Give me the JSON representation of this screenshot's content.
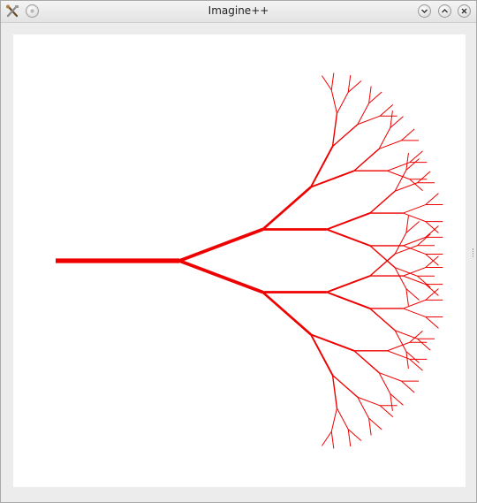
{
  "window": {
    "title": "Imagine++"
  },
  "icons": {
    "app": "app-tools-icon",
    "menu": "window-menu-icon",
    "minimize": "minimize-icon",
    "maximize": "maximize-icon",
    "close": "close-icon"
  },
  "drawing": {
    "shape": "fractal tree",
    "color": "#ee0000",
    "background": "#ffffff",
    "recursion_levels": 6
  }
}
